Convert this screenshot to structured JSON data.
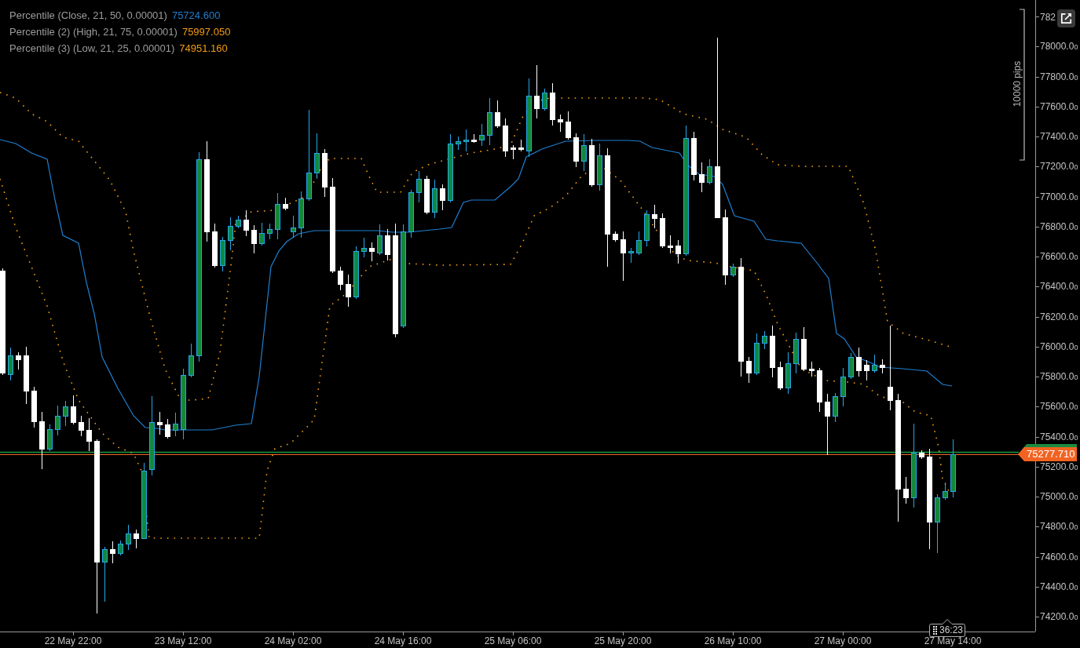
{
  "legend": [
    {
      "label": "Percentile (Close, 21, 50, 0.00001)",
      "value": "75724.600",
      "color": "#1f7fd0"
    },
    {
      "label": "Percentile (2) (High, 21, 75, 0.00001)",
      "value": "75997.050",
      "color": "#f39c12"
    },
    {
      "label": "Percentile (3) (Low, 21, 25, 0.00001)",
      "value": "74951.160",
      "color": "#f39c12"
    }
  ],
  "scale_marker": {
    "label": "10000 pips"
  },
  "price_axis": {
    "labels": [
      "782",
      "78000.0$_{0}$",
      "77800.0$_{0}$",
      "77600.0$_{0}$",
      "77400.0$_{0}$",
      "77200.0$_{0}$",
      "77000.0$_{0}$",
      "76800.0$_{0}$",
      "76600.0$_{0}$",
      "76400.0$_{0}$",
      "76200.0$_{0}$",
      "76000.0$_{0}$",
      "75800.0$_{0}$",
      "75600.0$_{0}$",
      "75400.0$_{0}$",
      "75200.0$_{0}$",
      "75000.0$_{0}$",
      "74800.0$_{0}$",
      "74600.0$_{0}$",
      "74400.0$_{0}$",
      "74200.0$_{0}$"
    ]
  },
  "price_tag": {
    "value": "75277.710"
  },
  "countdown": {
    "time": "36:23"
  },
  "time_axis": {
    "labels": [
      "22 May 22:00",
      "23 May 12:00",
      "24 May 02:00",
      "24 May 16:00",
      "25 May 06:00",
      "25 May 20:00",
      "26 May 10:00",
      "27 May 00:00",
      "27 May 14:00"
    ]
  }
}
